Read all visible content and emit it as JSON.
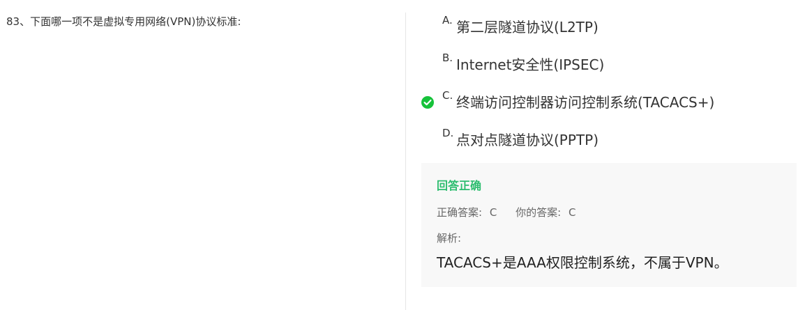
{
  "question": {
    "stem": "83、下面哪一项不是虚拟专用网络(VPN)协议标准:"
  },
  "options": [
    {
      "letter": "A.",
      "text": "第二层隧道协议(L2TP)",
      "selected": false,
      "correct": false
    },
    {
      "letter": "B.",
      "text": "Internet安全性(IPSEC)",
      "selected": false,
      "correct": false
    },
    {
      "letter": "C.",
      "text": "终端访问控制器访问控制系统(TACACS+)",
      "selected": true,
      "correct": true
    },
    {
      "letter": "D.",
      "text": "点对点隧道协议(PPTP)",
      "selected": false,
      "correct": false
    }
  ],
  "result": {
    "title": "回答正确",
    "correct_label": "正确答案:",
    "correct_value": "C",
    "your_label": "你的答案:",
    "your_value": "C",
    "analysis_label": "解析:",
    "analysis_text": "TACACS+是AAA权限控制系统，不属于VPN。"
  },
  "icons": {
    "correct_check": "check-circle-icon"
  },
  "colors": {
    "correct_green": "#2dbd6f",
    "check_green": "#16c23a",
    "panel_background": "#f8f8f8",
    "divider": "#e6e6e6"
  }
}
